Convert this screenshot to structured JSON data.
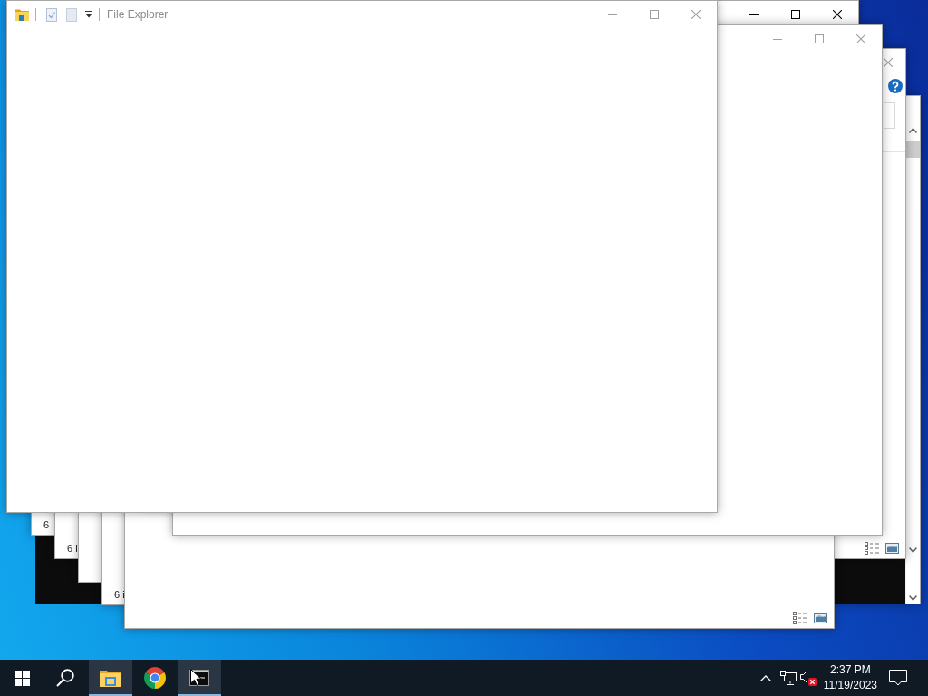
{
  "desktop": {
    "windows": [
      {
        "kind": "explorer"
      },
      {
        "kind": "console"
      },
      {
        "kind": "explorer",
        "active": false
      },
      {
        "kind": "explorer",
        "status": "6 i"
      },
      {
        "kind": "explorer",
        "status": "6 i"
      },
      {
        "kind": "explorer"
      },
      {
        "kind": "explorer",
        "status": "6 i"
      },
      {
        "kind": "explorer"
      },
      {
        "kind": "explorer",
        "active": true
      },
      {
        "kind": "explorer",
        "active": false
      },
      {
        "kind": "explorer",
        "active": false,
        "title": "File Explorer"
      }
    ]
  },
  "taskbar": {
    "apps": [
      {
        "kind": "explorer",
        "running": true
      },
      {
        "kind": "browser",
        "running": false
      },
      {
        "kind": "terminal",
        "running": true
      }
    ],
    "tray": {
      "volume": {
        "muted": true
      },
      "time": "2:37 PM",
      "date": "11/19/2023"
    }
  }
}
